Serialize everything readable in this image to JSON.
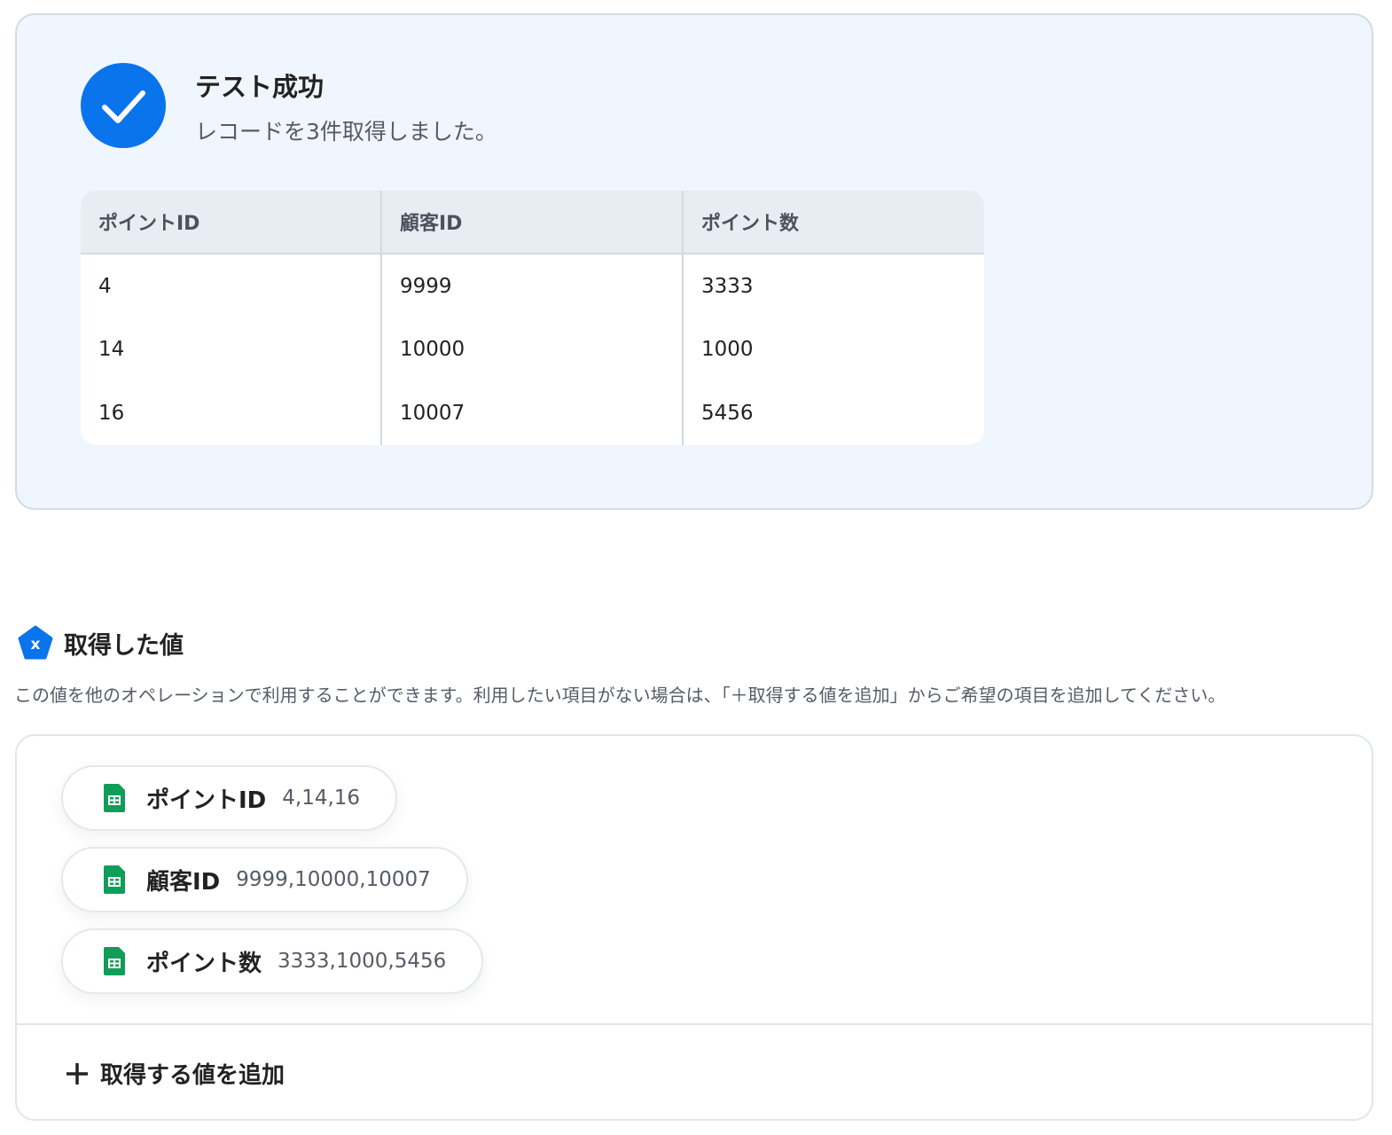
{
  "result": {
    "title": "テスト成功",
    "message": "レコードを3件取得しました。",
    "columns": [
      "ポイントID",
      "顧客ID",
      "ポイント数"
    ],
    "rows": [
      [
        "4",
        "9999",
        "3333"
      ],
      [
        "14",
        "10000",
        "1000"
      ],
      [
        "16",
        "10007",
        "5456"
      ]
    ]
  },
  "values_section": {
    "title": "取得した値",
    "description": "この値を他のオペレーションで利用することができます。利用したい項目がない場合は、「＋取得する値を追加」からご希望の項目を追加してください。",
    "items": [
      {
        "label": "ポイントID",
        "value": "4,14,16"
      },
      {
        "label": "顧客ID",
        "value": "9999,10000,10007"
      },
      {
        "label": "ポイント数",
        "value": "3333,1000,5456"
      }
    ],
    "add_label": "取得する値を追加"
  },
  "colors": {
    "accent": "#0a74ec",
    "sheets": "#0f9d58"
  }
}
